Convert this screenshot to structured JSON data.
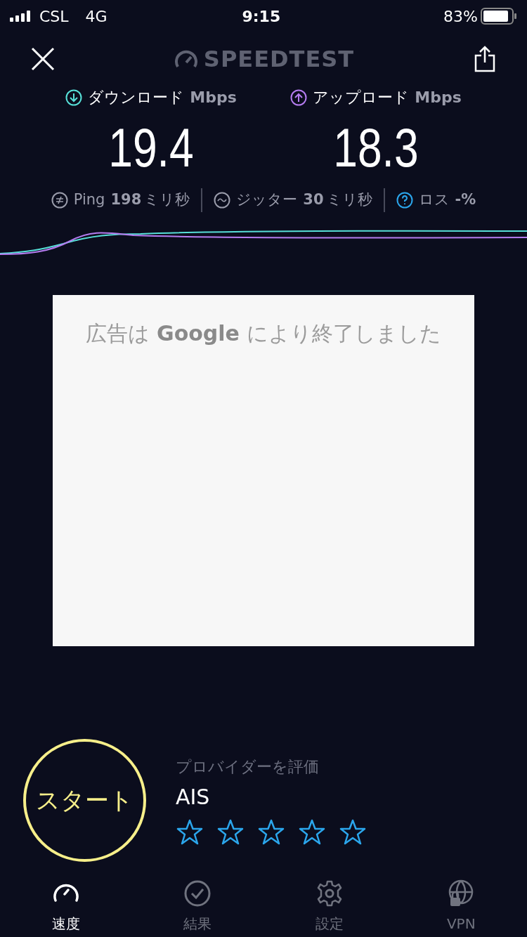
{
  "status_bar": {
    "carrier": "CSL",
    "network": "4G",
    "time": "9:15",
    "battery": "83%"
  },
  "header": {
    "logo": "SPEEDTEST"
  },
  "results": [
    {
      "kind": "download",
      "label": "ダウンロード",
      "unit": "Mbps",
      "value": "19.4"
    },
    {
      "kind": "upload",
      "label": "アップロード",
      "unit": "Mbps",
      "value": "18.3"
    }
  ],
  "metrics": [
    {
      "kind": "ping",
      "label": "Ping",
      "value": "198",
      "unit": "ミリ秒"
    },
    {
      "kind": "jitter",
      "label": "ジッター",
      "value": "30",
      "unit": "ミリ秒"
    },
    {
      "kind": "loss",
      "label": "ロス",
      "value": "-%"
    }
  ],
  "ad": {
    "text": "広告は **Google** により終了しました"
  },
  "start_button": {
    "label": "スタート"
  },
  "rating": {
    "prompt": "プロバイダーを評価",
    "provider": "AIS",
    "stars": 0
  },
  "tabs": [
    {
      "kind": "speed",
      "label": "速度",
      "selected": true
    },
    {
      "kind": "results",
      "label": "結果",
      "selected": false
    },
    {
      "kind": "settings",
      "label": "設定",
      "selected": false
    },
    {
      "kind": "vpn",
      "label": "VPN",
      "selected": false
    }
  ]
}
